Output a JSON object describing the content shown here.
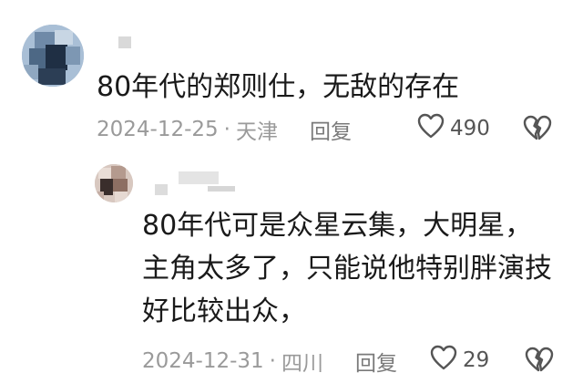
{
  "comment": {
    "text": "80年代的郑则仕，无敌的存在",
    "date": "2024-12-25",
    "separator": "·",
    "location": "天津",
    "reply_label": "回复",
    "like_count": "490"
  },
  "reply": {
    "lines": [
      "80年代可是众星云集，大明星，",
      "主角太多了，只能说他特别胖演技",
      "好比较出众，"
    ],
    "date": "2024-12-31",
    "separator": "·",
    "location": "四川",
    "reply_label": "回复",
    "like_count": "29"
  },
  "icons": {
    "like": "heart-outline-icon",
    "dislike": "broken-heart-icon"
  },
  "colors": {
    "text_primary": "#1a1a1a",
    "text_meta": "#9a9a9a",
    "icon": "#555555"
  }
}
